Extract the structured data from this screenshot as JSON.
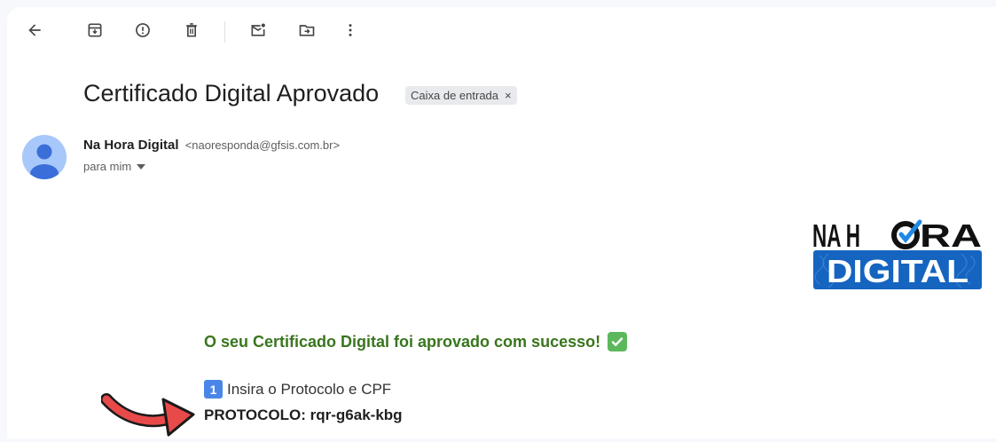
{
  "toolbar": {
    "icons": [
      "back-arrow-icon",
      "archive-icon",
      "report-spam-icon",
      "delete-icon",
      "mark-unread-icon",
      "move-to-icon",
      "more-options-icon"
    ]
  },
  "email": {
    "subject": "Certificado Digital Aprovado",
    "label": "Caixa de entrada",
    "label_remove": "×",
    "sender_name": "Na Hora Digital",
    "sender_email": "<naoresponda@gfsis.com.br>",
    "recipient": "para mim"
  },
  "logo": {
    "line1_a": "NA H",
    "line1_b": "RA",
    "line2": "DIGITAL"
  },
  "body": {
    "success_message": "O seu Certificado Digital foi aprovado com sucesso!",
    "step_number": "1",
    "step_text": "Insira o Protocolo e CPF",
    "protocol_line": "PROTOCOLO: rqr-g6ak-kbg"
  },
  "colors": {
    "success_green": "#38761d",
    "logo_blue": "#1565c0",
    "arrow_red": "#e84a4a"
  }
}
